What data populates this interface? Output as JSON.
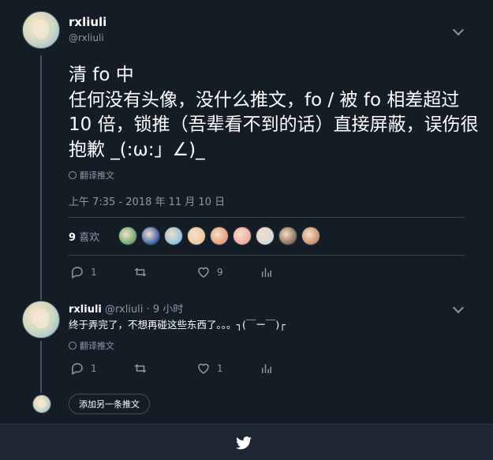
{
  "main_tweet": {
    "display_name": "rxliuli",
    "handle": "@rxliuli",
    "text": "清 fo 中\n任何没有头像，没什么推文，fo / 被 fo 相差超过 10 倍，锁推（吾辈看不到的话）直接屏蔽，误伤很抱歉 _(:ω:」∠)_",
    "translate_label": "翻译推文",
    "timestamp": "上午 7:35 - 2018 年 11 月 10 日",
    "likes_count": "9",
    "likes_label": "喜欢",
    "likers": [
      "#6aa86a",
      "#3a5ea8",
      "#8fc0e0",
      "#f0c7a0",
      "#e89a78",
      "#f3a7a0",
      "#d8d8d8",
      "#8a6a52",
      "#c98f6a"
    ],
    "reply_count": "1",
    "retweet_count": "",
    "like_count": "9"
  },
  "reply_tweet": {
    "display_name": "rxliuli",
    "handle": "@rxliuli",
    "time": "· 9 小时",
    "text": "终于弄完了，不想再碰这些东西了。。。┐(￣ー￣)┌",
    "translate_label": "翻译推文",
    "reply_count": "1",
    "retweet_count": "",
    "like_count": "1"
  },
  "add_tweet_label": "添加另一条推文",
  "colors": {
    "background": "#141d26",
    "text_secondary": "#8899a6",
    "divider": "#38444d"
  }
}
